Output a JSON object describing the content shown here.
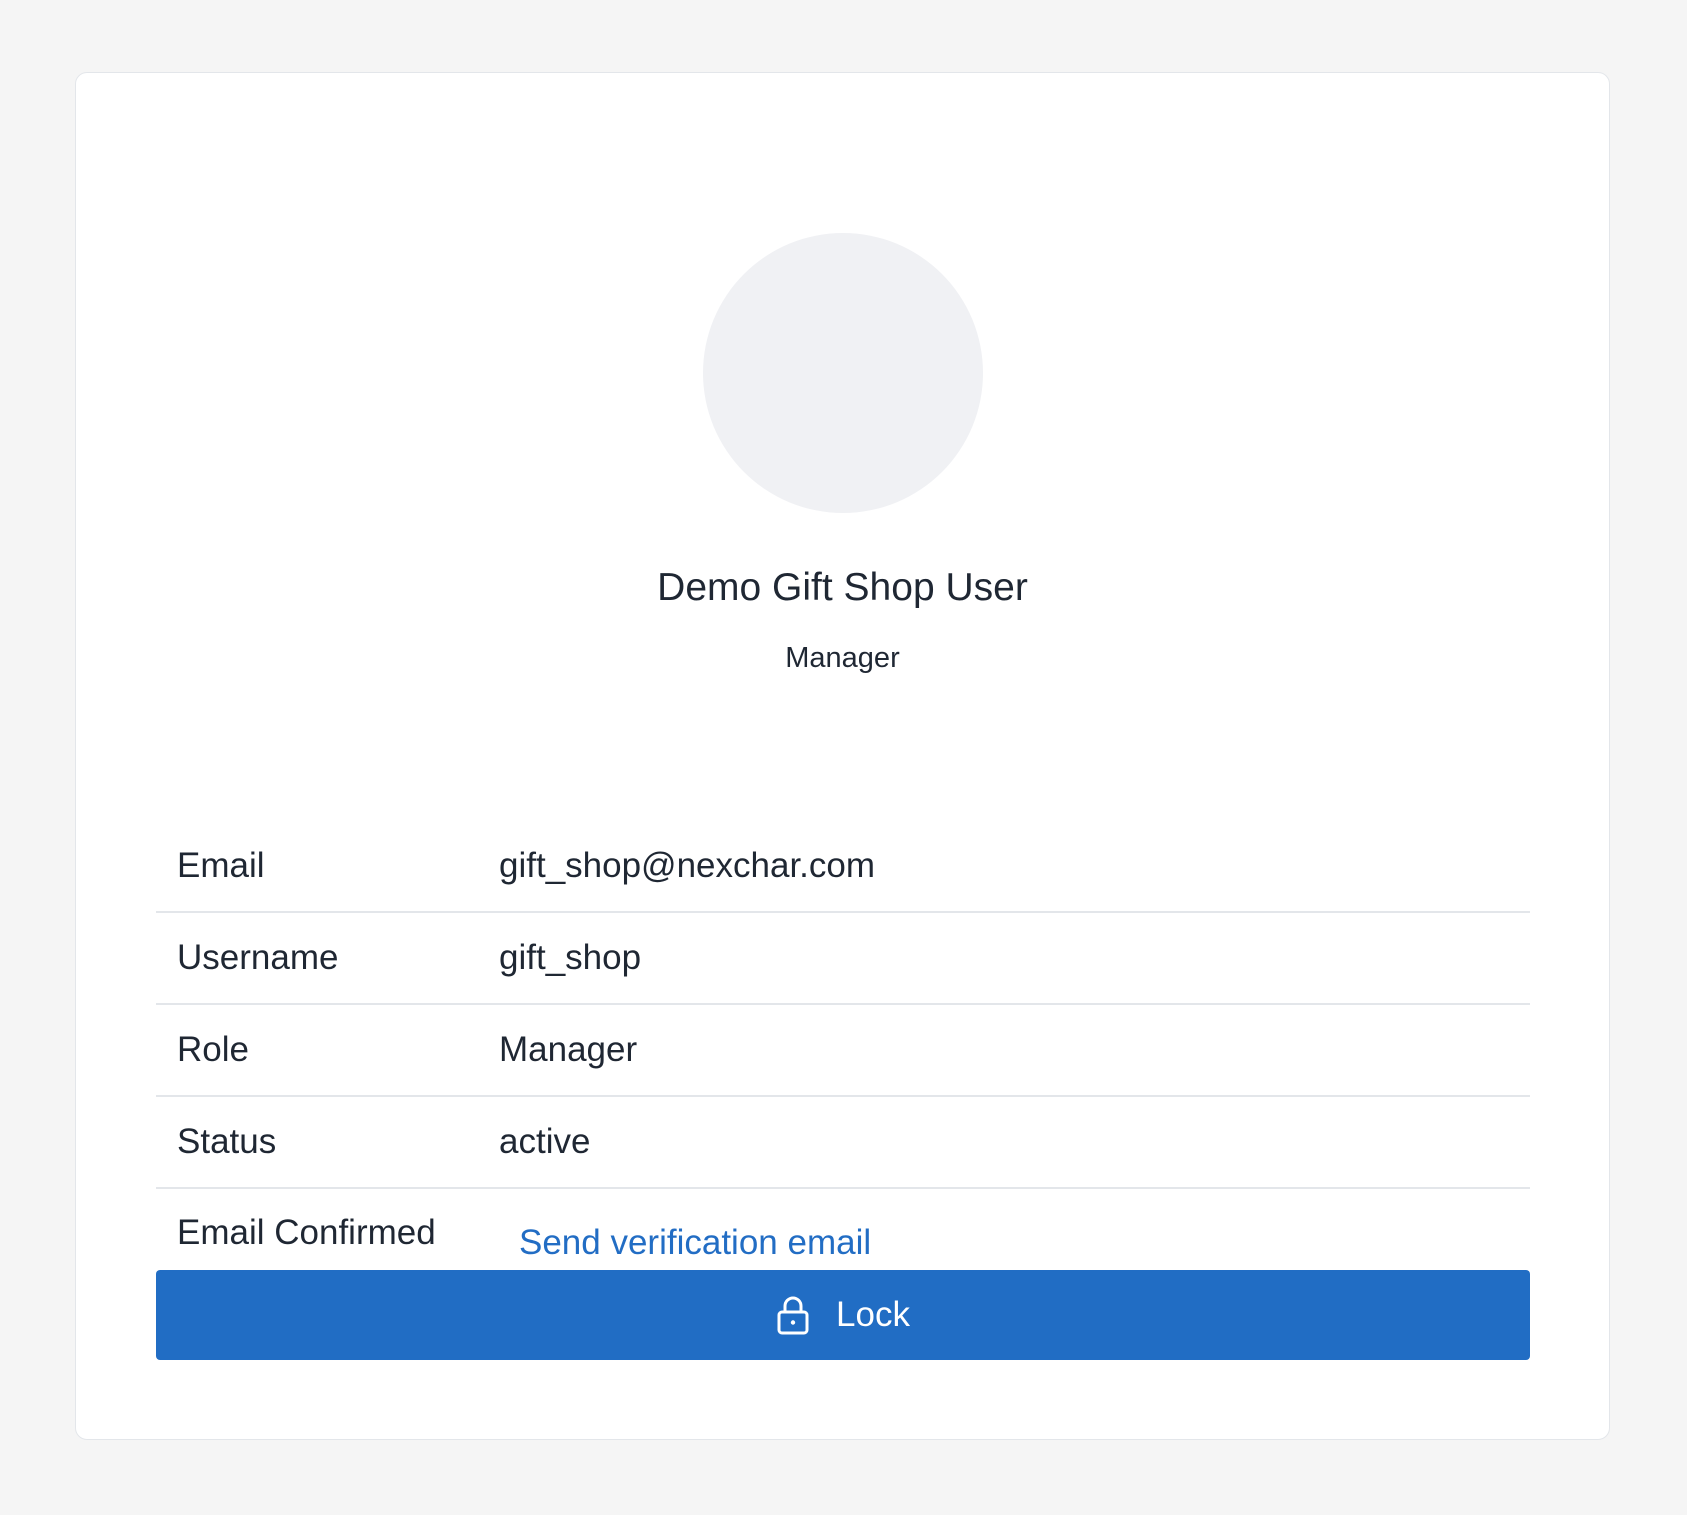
{
  "profile": {
    "name": "Demo Gift Shop User",
    "role": "Manager"
  },
  "details": [
    {
      "label": "Email",
      "value": "gift_shop@nexchar.com"
    },
    {
      "label": "Username",
      "value": "gift_shop"
    },
    {
      "label": "Role",
      "value": "Manager"
    },
    {
      "label": "Status",
      "value": "active"
    },
    {
      "label": "Email Confirmed",
      "link": "Send verification email"
    }
  ],
  "actions": {
    "lock_label": "Lock",
    "lock_icon": "lock-icon"
  },
  "colors": {
    "accent": "#216dc4",
    "link": "#226dc4",
    "avatar_bg": "#f0f1f4",
    "page_bg": "#f5f5f5"
  }
}
